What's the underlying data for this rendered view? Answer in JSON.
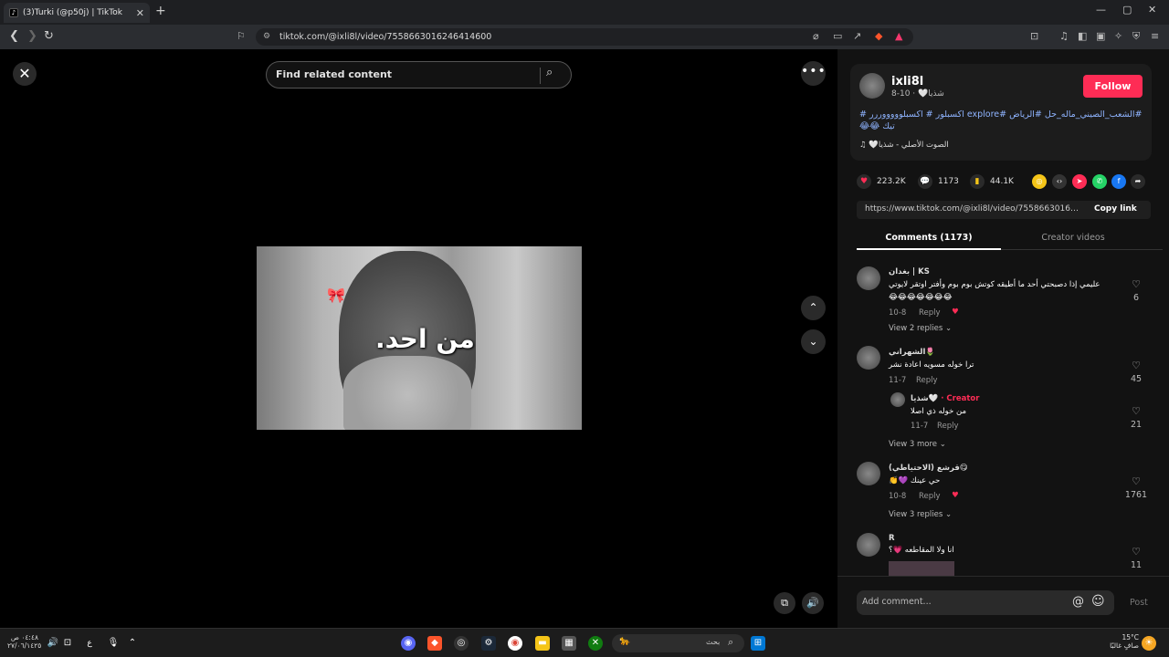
{
  "browser": {
    "tab_title": "(3)Turki (@p50j) | TikTok",
    "tab_favicon": "tiktok-icon",
    "url": "tiktok.com/@ixli8l/video/7558663016246414600"
  },
  "video": {
    "search_placeholder": "Find related content",
    "caption": "من احد."
  },
  "post": {
    "username": "ixli8l",
    "nickname": "شذيا🤍",
    "date": "10-8",
    "follow_label": "Follow",
    "hashtags": "#الشعب_الصيني_ماله_حل #الرياض #explore اكسبلور # اكسبلوووووررر # تيك 😂😂",
    "sound": "🤍الصوت الأصلي - شذيا",
    "likes": "223.2K",
    "comments_count": "1173",
    "saves": "44.1K",
    "link": "https://www.tiktok.com/@ixli8l/video/755866301624...",
    "copy_link_label": "Copy link",
    "tab_comments": "Comments (1173)",
    "tab_creator": "Creator videos"
  },
  "comments": [
    {
      "name": "بغدان | KS",
      "text": "عليمي إذا دصبحتي أحد ما أطيقه كوتش بوم بوم وأفتر اوتقر لايوتي",
      "emojis": "😂😂😂😂😂😂😂",
      "date": "10-8",
      "reply": "Reply",
      "likes": "6",
      "view_replies": "View 2 replies"
    },
    {
      "name": "الشهراني🌷",
      "text": "ترا خوله مسويه اعادة نشر",
      "date": "11-7",
      "reply": "Reply",
      "likes": "45"
    },
    {
      "name": "شذيا🤍",
      "creator_label": "· Creator",
      "text": "من خوله ذي اصلا",
      "date": "11-7",
      "reply": "Reply",
      "likes": "21",
      "view_more": "View 3 more"
    },
    {
      "name": "قرشع (الاحتياطي)😋",
      "text": "حي عينك 💜👏",
      "date": "10-8",
      "reply": "Reply",
      "likes": "1761",
      "view_replies": "View 3 replies"
    },
    {
      "name": "R",
      "text": "انا ولا المقاطعه 💗؟",
      "likes": "11"
    }
  ],
  "comment_box": {
    "placeholder": "Add comment...",
    "post_label": "Post"
  },
  "taskbar": {
    "time": "٠٤:٤٨ ص",
    "date": "٢٧/٠٦/١٤٢٥",
    "lang": "ع",
    "search_label": "بحث",
    "weather_temp": "15°C",
    "weather_desc": "صافٍ غالبًا"
  },
  "colors": {
    "accent": "#fe2c55",
    "hashtag": "#8fb4ff"
  }
}
